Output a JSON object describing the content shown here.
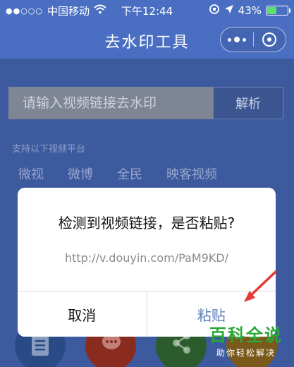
{
  "status_bar": {
    "signal": "●●○○○",
    "carrier": "中国移动",
    "time": "下午12:44",
    "battery_text": "43%",
    "battery_level": 0.43,
    "icons": [
      "wifi-icon",
      "rotation-lock-icon",
      "location-icon",
      "battery-icon"
    ]
  },
  "nav": {
    "title": "去水印工具",
    "icons": [
      "more-dots-icon",
      "close-ring-icon"
    ]
  },
  "page": {
    "input_placeholder": "请输入视频链接去水印",
    "parse_label": "解析",
    "support_title": "支持以下视频平台",
    "platforms": [
      "微视",
      "微博",
      "全民",
      "映客视频"
    ],
    "bottom_icons": [
      "document-icon",
      "chat-icon",
      "share-icon",
      "app-icon"
    ]
  },
  "dialog": {
    "title": "检测到视频链接，是否粘贴?",
    "url": "http://v.douyin.com/PaM9KD/",
    "cancel_label": "取消",
    "confirm_label": "粘贴"
  },
  "watermark": {
    "title": "百科全说",
    "subtitle": "助你轻松解决"
  },
  "colors": {
    "nav_blue": "#4a6fc2",
    "dimmed_bg": "#3e5a9e",
    "confirm_blue": "#5d7fb8",
    "arrow_red": "#e53935",
    "watermark_green": "#2aa838"
  }
}
